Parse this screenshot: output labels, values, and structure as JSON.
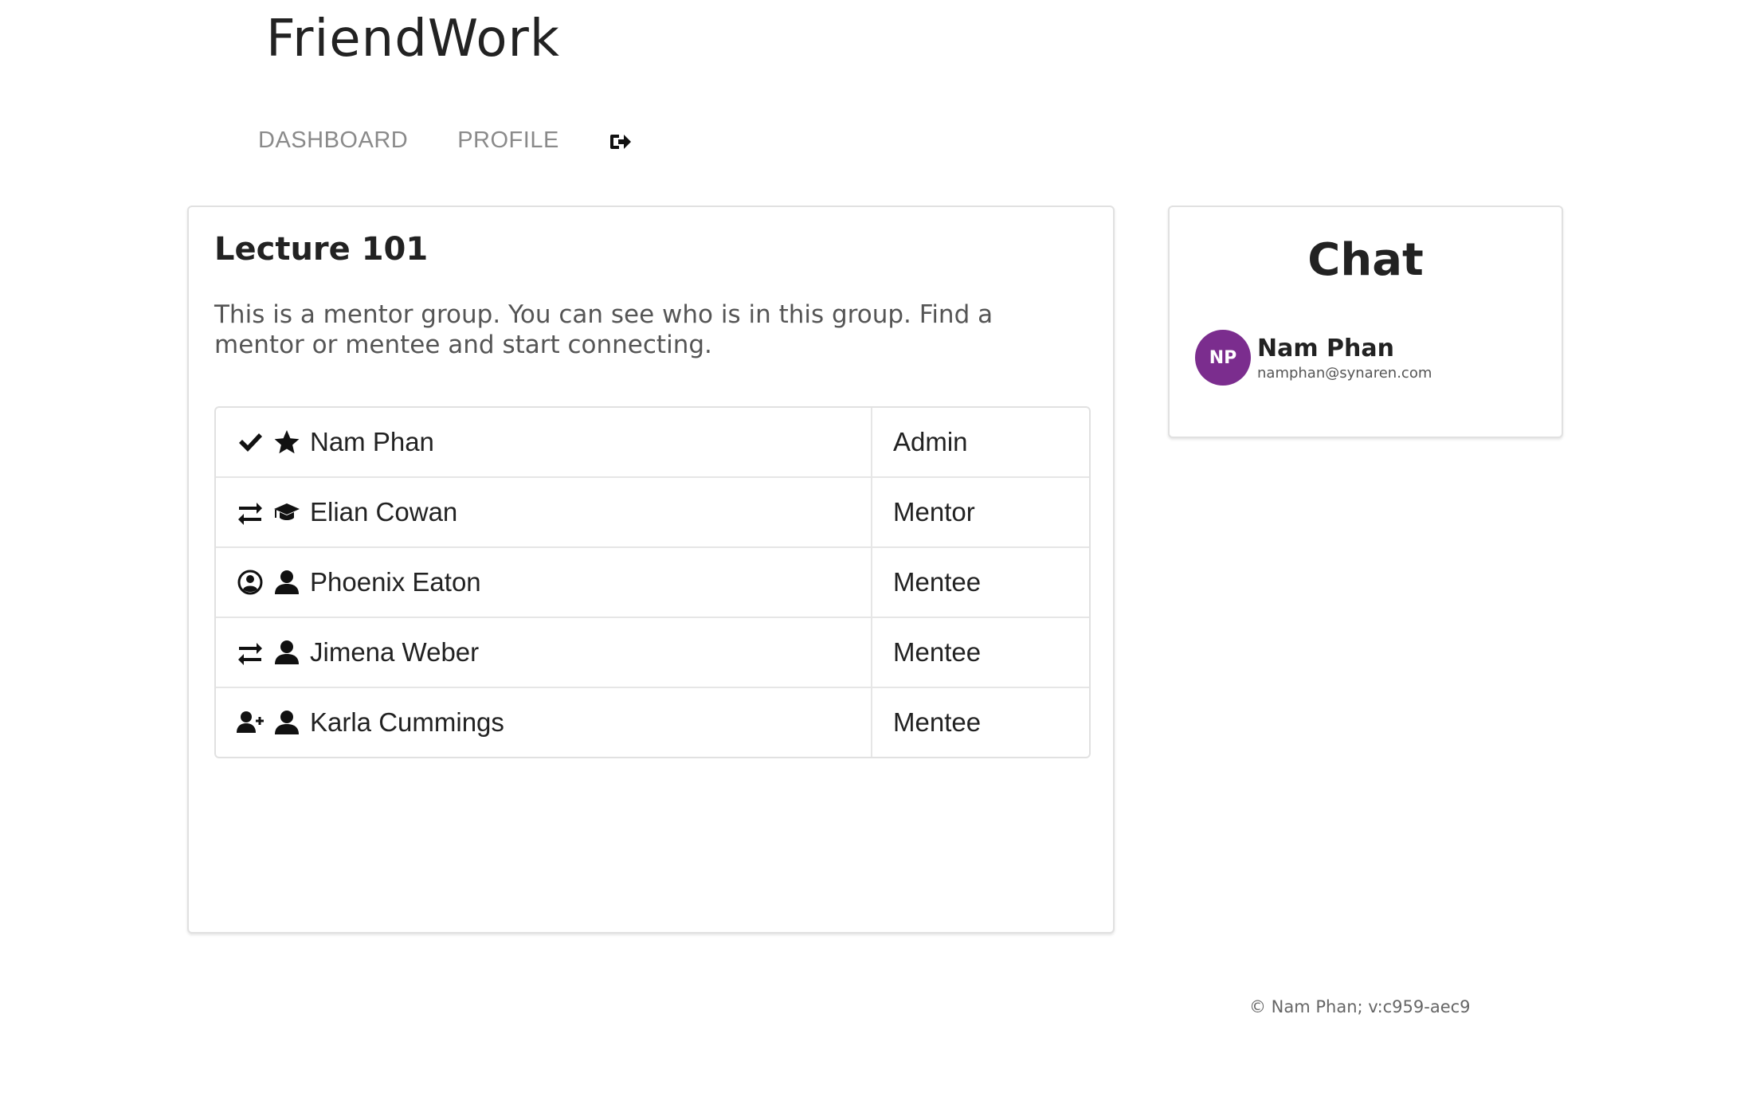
{
  "app": {
    "brand": "FriendWork"
  },
  "nav": {
    "items": [
      {
        "label": "DASHBOARD"
      },
      {
        "label": "PROFILE"
      }
    ],
    "logout_icon": "sign-out-icon"
  },
  "group": {
    "title": "Lecture 101",
    "description": "This is a mentor group. You can see who is in this group. Find a mentor or mentee and start connecting.",
    "members": [
      {
        "status_icon": "check-icon",
        "role_icon": "star-icon",
        "name": "Nam Phan",
        "role": "Admin"
      },
      {
        "status_icon": "exchange-icon",
        "role_icon": "graduation-cap-icon",
        "name": "Elian Cowan",
        "role": "Mentor"
      },
      {
        "status_icon": "user-circle-icon",
        "role_icon": "user-icon",
        "name": "Phoenix Eaton",
        "role": "Mentee"
      },
      {
        "status_icon": "exchange-icon",
        "role_icon": "user-icon",
        "name": "Jimena Weber",
        "role": "Mentee"
      },
      {
        "status_icon": "user-plus-icon",
        "role_icon": "user-icon",
        "name": "Karla Cummings",
        "role": "Mentee"
      }
    ]
  },
  "chat": {
    "title": "Chat",
    "user": {
      "initials": "NP",
      "name": "Nam Phan",
      "email": "namphan@synaren.com",
      "avatar_color": "#7b2d8e"
    }
  },
  "footer": {
    "text": "© Nam Phan; v:c959-aec9"
  }
}
